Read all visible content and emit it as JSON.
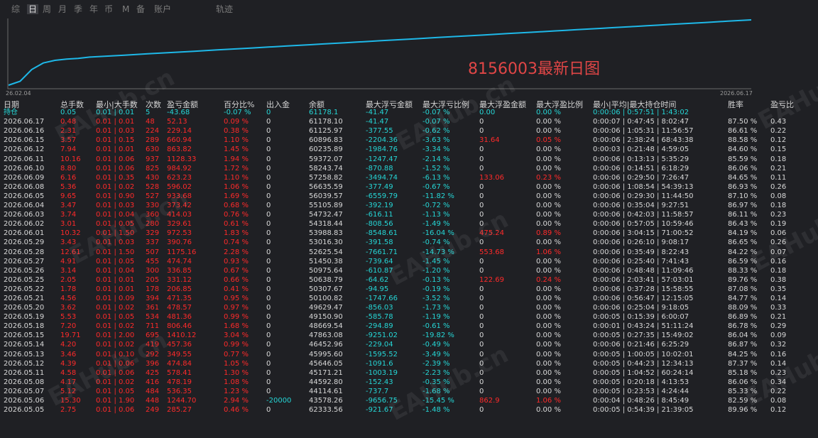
{
  "tabs": [
    "综",
    "日",
    "周",
    "月",
    "季",
    "年",
    "币",
    "M",
    "备",
    "账户"
  ],
  "active_tab": "日",
  "track_label": "轨迹",
  "chart": {
    "title": "8156003最新日图",
    "x_start": "26.02.04",
    "x_end": "2026.06.17",
    "line_color": "#1eb8e8"
  },
  "chart_data": {
    "type": "line",
    "title": "8156003最新日图",
    "x": [
      "26.02.04",
      "2026.06.17"
    ],
    "series": [
      {
        "values": [
          0,
          6,
          24,
          34,
          38,
          40,
          41,
          43,
          44,
          45,
          46,
          47,
          48,
          49,
          50,
          51,
          52,
          53,
          54,
          55,
          56,
          57,
          58,
          59,
          60,
          61,
          62,
          63,
          64,
          65,
          66,
          67,
          68,
          69,
          70,
          71,
          72,
          73,
          74,
          75,
          76,
          77,
          78,
          79,
          80,
          81,
          82,
          83,
          84,
          85,
          86,
          87,
          88,
          89,
          90,
          91,
          92,
          93,
          94,
          95,
          96,
          97,
          98,
          99,
          100
        ]
      }
    ]
  },
  "headers": [
    "日期",
    "总手数",
    "最小|大手数",
    "次数",
    "盈亏金额",
    "百分比%",
    "出入金",
    "余额",
    "最大浮亏金额",
    "最大浮亏比例",
    "最大浮盈金额",
    "最大浮盈比例",
    "最小|平均|最大持仓时间",
    "胜率",
    "盈亏比"
  ],
  "position_row": [
    "持仓",
    "0.05",
    "0.01 | 0.01",
    "5",
    "-43.68",
    "-0.07 %",
    "0",
    "61178.1",
    "-41.47",
    "-0.07 %",
    "0.00",
    "0.00 %",
    "0:00:06 | 0:57:51 | 1:43:02",
    "",
    ""
  ],
  "rows": [
    [
      "2026.06.17",
      "0.48",
      "0.01 | 0.01",
      "48",
      "52.13",
      "0.09 %",
      "0",
      "61178.10",
      "-41.47",
      "-0.07 %",
      "0",
      "0.00 %",
      "0:00:07 | 0:47:45 | 8:02:47",
      "87.50 %",
      "0.43"
    ],
    [
      "2026.06.16",
      "2.31",
      "0.01 | 0.03",
      "224",
      "229.14",
      "0.38 %",
      "0",
      "61125.97",
      "-377.55",
      "-0.62 %",
      "0",
      "0.00 %",
      "0:00:06 | 1:05:31 | 11:56:57",
      "86.61 %",
      "0.22"
    ],
    [
      "2026.06.15",
      "3.57",
      "0.01 | 0.15",
      "289",
      "660.94",
      "1.10 %",
      "0",
      "60896.83",
      "-2204.36",
      "-3.63 %",
      "31.64",
      "0.05 %",
      "0:00:06 | 2:38:24 | 68:43:38",
      "88.58 %",
      "0.12"
    ],
    [
      "2026.06.12",
      "7.94",
      "0.01 | 0.01",
      "630",
      "863.82",
      "1.45 %",
      "0",
      "60235.89",
      "-1984.76",
      "-3.34 %",
      "0",
      "0.00 %",
      "0:00:03 | 0:21:48 | 4:59:05",
      "84.60 %",
      "0.15"
    ],
    [
      "2026.06.11",
      "10.16",
      "0.01 | 0.06",
      "937",
      "1128.33",
      "1.94 %",
      "0",
      "59372.07",
      "-1247.47",
      "-2.14 %",
      "0",
      "0.00 %",
      "0:00:06 | 0:13:13 | 5:35:29",
      "85.59 %",
      "0.18"
    ],
    [
      "2026.06.10",
      "8.80",
      "0.01 | 0.06",
      "825",
      "984.92",
      "1.72 %",
      "0",
      "58243.74",
      "-870.88",
      "-1.52 %",
      "0",
      "0.00 %",
      "0:00:06 | 0:14:51 | 6:18:29",
      "86.06 %",
      "0.21"
    ],
    [
      "2026.06.09",
      "6.16",
      "0.01 | 0.35",
      "430",
      "623.23",
      "1.10 %",
      "0",
      "57258.82",
      "-3494.74",
      "-6.13 %",
      "133.06",
      "0.23 %",
      "0:00:06 | 0:29:50 | 7:26:47",
      "84.65 %",
      "0.11"
    ],
    [
      "2026.06.08",
      "5.36",
      "0.01 | 0.02",
      "528",
      "596.02",
      "1.06 %",
      "0",
      "56635.59",
      "-377.49",
      "-0.67 %",
      "0",
      "0.00 %",
      "0:00:06 | 1:08:54 | 54:39:13",
      "86.93 %",
      "0.26"
    ],
    [
      "2026.06.05",
      "9.65",
      "0.01 | 0.90",
      "527",
      "933.68",
      "1.69 %",
      "0",
      "56039.57",
      "-6559.79",
      "-11.82 %",
      "0",
      "0.00 %",
      "0:00:06 | 0:29:30 | 11:44:50",
      "87.10 %",
      "0.08"
    ],
    [
      "2026.06.04",
      "3.47",
      "0.01 | 0.03",
      "330",
      "373.42",
      "0.68 %",
      "0",
      "55105.89",
      "-392.19",
      "-0.72 %",
      "0",
      "0.00 %",
      "0:00:06 | 0:35:04 | 9:27:51",
      "86.97 %",
      "0.18"
    ],
    [
      "2026.06.03",
      "3.74",
      "0.01 | 0.04",
      "360",
      "414.03",
      "0.76 %",
      "0",
      "54732.47",
      "-616.11",
      "-1.13 %",
      "0",
      "0.00 %",
      "0:00:06 | 0:42:03 | 11:58:57",
      "86.11 %",
      "0.23"
    ],
    [
      "2026.06.02",
      "3.01",
      "0.01 | 0.05",
      "280",
      "329.61",
      "0.61 %",
      "0",
      "54318.44",
      "-808.56",
      "-1.49 %",
      "0",
      "0.00 %",
      "0:00:06 | 0:57:05 | 10:59:46",
      "86.43 %",
      "0.19"
    ],
    [
      "2026.06.01",
      "10.32",
      "0.01 | 1.50",
      "329",
      "972.53",
      "1.83 %",
      "0",
      "53988.83",
      "-8548.61",
      "-16.04 %",
      "475.24",
      "0.89 %",
      "0:00:06 | 3:04:15 | 71:00:52",
      "84.19 %",
      "0.06"
    ],
    [
      "2026.05.29",
      "3.43",
      "0.01 | 0.03",
      "337",
      "390.76",
      "0.74 %",
      "0",
      "53016.30",
      "-391.58",
      "-0.74 %",
      "0",
      "0.00 %",
      "0:00:06 | 0:26:10 | 9:08:17",
      "86.65 %",
      "0.26"
    ],
    [
      "2026.05.28",
      "12.61",
      "0.01 | 1.50",
      "507",
      "1175.16",
      "2.28 %",
      "0",
      "52625.54",
      "-7661.71",
      "-14.73 %",
      "553.68",
      "1.06 %",
      "0:00:06 | 0:35:49 | 8:22:43",
      "84.22 %",
      "0.07"
    ],
    [
      "2026.05.27",
      "4.91",
      "0.01 | 0.05",
      "455",
      "474.74",
      "0.93 %",
      "0",
      "51450.38",
      "-739.64",
      "-1.45 %",
      "0",
      "0.00 %",
      "0:00:06 | 0:25:40 | 7:41:43",
      "86.59 %",
      "0.16"
    ],
    [
      "2026.05.26",
      "3.14",
      "0.01 | 0.04",
      "300",
      "336.85",
      "0.67 %",
      "0",
      "50975.64",
      "-610.87",
      "-1.20 %",
      "0",
      "0.00 %",
      "0:00:06 | 0:48:48 | 11:09:46",
      "88.33 %",
      "0.18"
    ],
    [
      "2026.05.25",
      "2.05",
      "0.01 | 0.01",
      "205",
      "331.12",
      "0.66 %",
      "0",
      "50638.79",
      "-64.62",
      "-0.13 %",
      "122.69",
      "0.24 %",
      "0:00:06 | 2:03:41 | 57:03:01",
      "89.76 %",
      "0.38"
    ],
    [
      "2026.05.22",
      "1.78",
      "0.01 | 0.01",
      "178",
      "206.85",
      "0.41 %",
      "0",
      "50307.67",
      "-94.95",
      "-0.19 %",
      "0",
      "0.00 %",
      "0:00:06 | 0:37:28 | 15:58:55",
      "87.08 %",
      "0.35"
    ],
    [
      "2026.05.21",
      "4.56",
      "0.01 | 0.09",
      "394",
      "471.35",
      "0.95 %",
      "0",
      "50100.82",
      "-1747.66",
      "-3.52 %",
      "0",
      "0.00 %",
      "0:00:06 | 0:56:47 | 12:15:05",
      "84.77 %",
      "0.14"
    ],
    [
      "2026.05.20",
      "3.62",
      "0.01 | 0.02",
      "361",
      "478.57",
      "0.97 %",
      "0",
      "49629.47",
      "-856.03",
      "-1.73 %",
      "0",
      "0.00 %",
      "0:00:06 | 0:25:04 | 9:18:05",
      "88.09 %",
      "0.33"
    ],
    [
      "2026.05.19",
      "5.53",
      "0.01 | 0.05",
      "534",
      "481.36",
      "0.99 %",
      "0",
      "49150.90",
      "-585.78",
      "-1.19 %",
      "0",
      "0.00 %",
      "0:00:05 | 0:15:39 | 6:00:07",
      "86.89 %",
      "0.21"
    ],
    [
      "2026.05.18",
      "7.20",
      "0.01 | 0.02",
      "711",
      "806.46",
      "1.68 %",
      "0",
      "48669.54",
      "-294.89",
      "-0.61 %",
      "0",
      "0.00 %",
      "0:00:01 | 0:43:24 | 51:11:24",
      "86.78 %",
      "0.29"
    ],
    [
      "2026.05.15",
      "19.71",
      "0.01 | 2.00",
      "695",
      "1410.12",
      "3.04 %",
      "0",
      "47863.08",
      "-9251.02",
      "-19.82 %",
      "0",
      "0.00 %",
      "0:00:05 | 0:27:35 | 15:49:02",
      "86.04 %",
      "0.09"
    ],
    [
      "2026.05.14",
      "4.20",
      "0.01 | 0.02",
      "419",
      "457.36",
      "0.99 %",
      "0",
      "46452.96",
      "-229.04",
      "-0.49 %",
      "0",
      "0.00 %",
      "0:00:06 | 0:21:46 | 6:25:29",
      "86.87 %",
      "0.32"
    ],
    [
      "2026.05.13",
      "3.46",
      "0.01 | 0.10",
      "292",
      "349.55",
      "0.77 %",
      "0",
      "45995.60",
      "-1595.52",
      "-3.49 %",
      "0",
      "0.00 %",
      "0:00:05 | 1:00:05 | 10:02:01",
      "84.25 %",
      "0.16"
    ],
    [
      "2026.05.12",
      "4.39",
      "0.01 | 0.06",
      "396",
      "474.84",
      "1.05 %",
      "0",
      "45646.05",
      "-1091.6",
      "-2.39 %",
      "0",
      "0.00 %",
      "0:00:05 | 0:44:23 | 12:34:13",
      "87.37 %",
      "0.14"
    ],
    [
      "2026.05.11",
      "4.58",
      "0.01 | 0.06",
      "425",
      "578.41",
      "1.30 %",
      "0",
      "45171.21",
      "-1003.19",
      "-2.23 %",
      "0",
      "0.00 %",
      "0:00:05 | 1:04:52 | 60:24:14",
      "85.18 %",
      "0.23"
    ],
    [
      "2026.05.08",
      "4.17",
      "0.01 | 0.02",
      "416",
      "478.19",
      "1.08 %",
      "0",
      "44592.80",
      "-152.43",
      "-0.35 %",
      "0",
      "0.00 %",
      "0:00:05 | 0:20:18 | 4:13:53",
      "86.06 %",
      "0.34"
    ],
    [
      "2026.05.07",
      "5.12",
      "0.01 | 0.05",
      "484",
      "536.35",
      "1.23 %",
      "0",
      "44114.61",
      "-737.7",
      "-1.68 %",
      "0",
      "0.00 %",
      "0:00:05 | 0:23:53 | 4:24:44",
      "85.33 %",
      "0.22"
    ],
    [
      "2026.05.06",
      "15.30",
      "0.01 | 1.90",
      "448",
      "1244.70",
      "2.94 %",
      "-20000",
      "43578.26",
      "-9656.75",
      "-15.45 %",
      "862.9",
      "1.06 %",
      "0:00:04 | 0:48:26 | 8:45:49",
      "82.59 %",
      "0.08"
    ],
    [
      "2026.05.05",
      "2.75",
      "0.01 | 0.06",
      "249",
      "285.27",
      "0.46 %",
      "0",
      "62333.56",
      "-921.67",
      "-1.48 %",
      "0",
      "0.00 %",
      "0:00:05 | 0:54:39 | 21:39:05",
      "89.96 %",
      "0.12"
    ]
  ],
  "watermark": "EAHub.cn"
}
